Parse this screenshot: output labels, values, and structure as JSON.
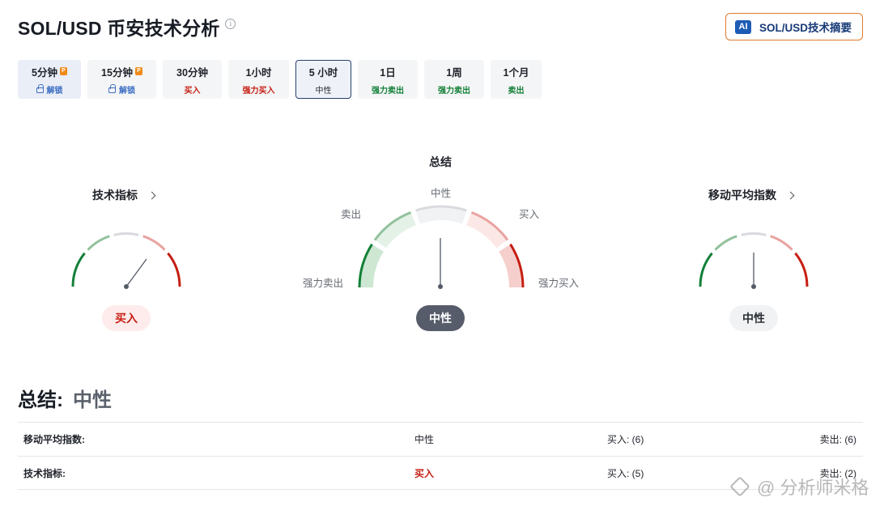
{
  "header": {
    "title": "SOL/USD 币安技术分析",
    "ai_button_badge": "AI",
    "ai_button_label": "SOL/USD技术摘要"
  },
  "tabs": [
    {
      "label": "5分钟",
      "sub": "解锁",
      "locked": true
    },
    {
      "label": "15分钟",
      "sub": "解锁",
      "locked": true
    },
    {
      "label": "30分钟",
      "sub": "买入",
      "sub_color": "#c61e12"
    },
    {
      "label": "1小时",
      "sub": "强力买入",
      "sub_color": "#c61e12"
    },
    {
      "label": "5 小时",
      "sub": "中性",
      "sub_color": "#2b2f36",
      "active": true
    },
    {
      "label": "1日",
      "sub": "强力卖出",
      "sub_color": "#138038"
    },
    {
      "label": "1周",
      "sub": "强力卖出",
      "sub_color": "#138038"
    },
    {
      "label": "1个月",
      "sub": "卖出",
      "sub_color": "#138038"
    }
  ],
  "gauges": {
    "technical": {
      "title": "技术指标",
      "result": "买入"
    },
    "summary": {
      "title": "总结",
      "result": "中性",
      "labels": {
        "neutral": "中性",
        "sell": "卖出",
        "buy": "买入",
        "strong_sell": "强力卖出",
        "strong_buy": "强力买入"
      }
    },
    "moving_average": {
      "title": "移动平均指数",
      "result": "中性"
    }
  },
  "summary": {
    "label": "总结:",
    "value": "中性"
  },
  "table": [
    {
      "name": "移动平均指数:",
      "status": "中性",
      "buy": "买入: (6)",
      "sell": "卖出: (6)"
    },
    {
      "name": "技术指标:",
      "status": "买入",
      "buy": "买入: (5)",
      "sell": "卖出: (2)"
    }
  ],
  "watermark": "@ 分析师米格",
  "colors": {
    "buy": "#c61e12",
    "sell": "#138038",
    "neutral": "#565c69",
    "accent": "#e07a2b"
  }
}
